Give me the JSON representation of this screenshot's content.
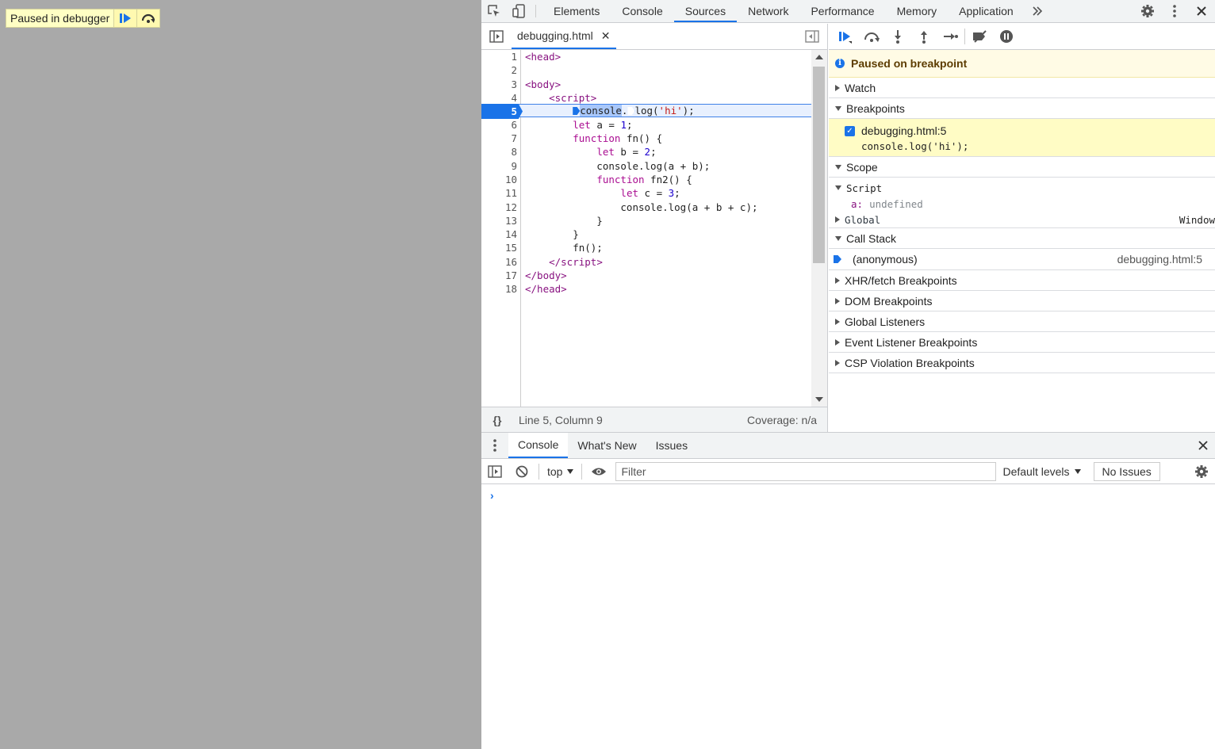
{
  "page": {
    "paused_label": "Paused in debugger"
  },
  "devtools": {
    "main_tabs": [
      "Elements",
      "Console",
      "Sources",
      "Network",
      "Performance",
      "Memory",
      "Application"
    ],
    "active_tab": "Sources"
  },
  "editor": {
    "file_tab": "debugging.html",
    "lines": [
      "1",
      "2",
      "3",
      "4",
      "5",
      "6",
      "7",
      "8",
      "9",
      "10",
      "11",
      "12",
      "13",
      "14",
      "15",
      "16",
      "17",
      "18"
    ],
    "status": {
      "position": "Line 5, Column 9",
      "coverage": "Coverage: n/a"
    }
  },
  "sidebar": {
    "paused_message": "Paused on breakpoint",
    "sections": {
      "watch": "Watch",
      "breakpoints": "Breakpoints",
      "scope": "Scope",
      "call_stack": "Call Stack",
      "xhr": "XHR/fetch Breakpoints",
      "dom": "DOM Breakpoints",
      "global_listeners": "Global Listeners",
      "event_listener": "Event Listener Breakpoints",
      "csp": "CSP Violation Breakpoints"
    },
    "breakpoint": {
      "location": "debugging.html:5",
      "source": "console.log('hi');"
    },
    "scope": {
      "script_label": "Script",
      "var_name": "a:",
      "var_value": "undefined",
      "global_label": "Global",
      "global_value": "Window"
    },
    "call_stack": {
      "function": "(anonymous)",
      "location": "debugging.html:5"
    }
  },
  "drawer": {
    "tabs": [
      "Console",
      "What's New",
      "Issues"
    ],
    "context": "top",
    "filter_placeholder": "Filter",
    "levels": "Default levels",
    "issues_button": "No Issues",
    "prompt": "›"
  },
  "colors": {
    "accent": "#1a73e8",
    "page_background": "#a9a9a9",
    "paused_banner": "#fffbe5",
    "breakpoint_highlight": "#fffcc5"
  }
}
